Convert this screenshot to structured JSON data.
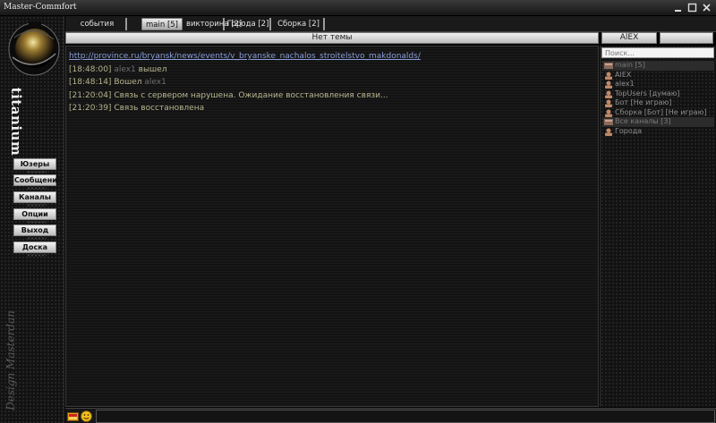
{
  "window": {
    "title": "Master-Commfort"
  },
  "sidebar": {
    "brand": "titanium",
    "designer": "Design Masterdan",
    "buttons": [
      {
        "label": "Юзеры"
      },
      {
        "label": "Сообщение"
      },
      {
        "label": "Каналы"
      },
      {
        "label": "Опции"
      },
      {
        "label": "Выход"
      },
      {
        "label": "Доска"
      }
    ]
  },
  "tabs": [
    {
      "label": "события",
      "active": false
    },
    {
      "label": "main [5]",
      "active": true
    },
    {
      "label": "викторина [2]",
      "active": false
    },
    {
      "label": "Города [2]",
      "active": false
    },
    {
      "label": "Сборка [2]",
      "active": false
    }
  ],
  "topic": "Нет темы",
  "current_nick": "AlEX",
  "chat": {
    "link": "http://province.ru/bryansk/news/events/v_bryanske_nachalos_stroitelstvo_makdonalds/",
    "messages": [
      {
        "time": "[18:48:00]",
        "pre": "",
        "nick": "alex1",
        "post": " вышел"
      },
      {
        "time": "[18:48:14]",
        "pre": " Вошел ",
        "nick": "alex1",
        "post": ""
      },
      {
        "time": "[21:20:04]",
        "pre": " Связь с сервером нарушена. Ожидание восстановления связи...",
        "nick": "",
        "post": ""
      },
      {
        "time": "[21:20:39]",
        "pre": " Связь восстановлена",
        "nick": "",
        "post": ""
      }
    ]
  },
  "users": {
    "search_placeholder": "Поиск...",
    "items": [
      {
        "label": "main [5]",
        "type": "channel",
        "header": true
      },
      {
        "label": "AlEX",
        "type": "user",
        "header": false
      },
      {
        "label": "alex1",
        "type": "user",
        "header": false
      },
      {
        "label": "TopUsers [думаю]",
        "type": "user",
        "header": false
      },
      {
        "label": "Бот [Не играю]",
        "type": "user",
        "header": false
      },
      {
        "label": "Сборка [Бот] [Не играю]",
        "type": "user",
        "header": false
      },
      {
        "label": "Все каналы [3]",
        "type": "channel",
        "header": true
      },
      {
        "label": "Города",
        "type": "user",
        "header": false
      }
    ]
  },
  "colors": {
    "link": "#8a9ed8",
    "timestamp": "#b6b38e",
    "nick": "#6e6e6e",
    "user_icon": "#c08a6a"
  }
}
